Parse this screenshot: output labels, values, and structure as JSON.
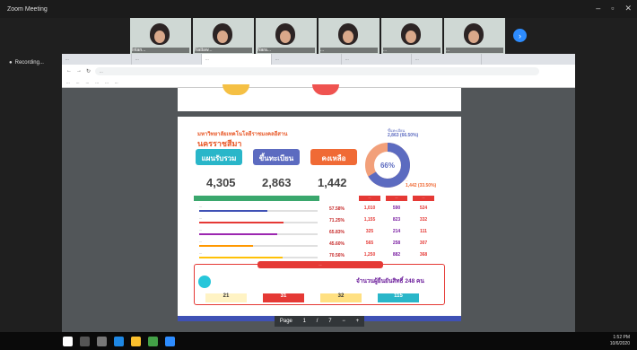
{
  "window": {
    "title": "Zoom Meeting"
  },
  "gallery": {
    "participants": [
      {
        "name": "Intan..."
      },
      {
        "name": "Nattaw..."
      },
      {
        "name": "Nara..."
      },
      {
        "name": "..."
      },
      {
        "name": "..."
      },
      {
        "name": "..."
      }
    ]
  },
  "recording": {
    "label": "Recording..."
  },
  "browser": {
    "tabs": [
      {
        "label": "..."
      },
      {
        "label": "..."
      },
      {
        "label": "..."
      },
      {
        "label": "..."
      },
      {
        "label": "..."
      },
      {
        "label": "..."
      }
    ],
    "url": "...",
    "bookmarks": [
      {
        "label": "..."
      },
      {
        "label": "..."
      },
      {
        "label": "..."
      },
      {
        "label": "..."
      },
      {
        "label": "..."
      },
      {
        "label": "..."
      }
    ]
  },
  "slide": {
    "heading_line1": "มหาวิทยาลัยเทคโนโลยีราชมงคลอีสาน",
    "heading_line2": "นครราชสีมา",
    "pills": [
      {
        "label": "แผนรับรวม",
        "value": "4,305",
        "color": "#29b6c9"
      },
      {
        "label": "ขึ้นทะเบียน",
        "value": "2,863",
        "color": "#5c6bc0"
      },
      {
        "label": "คงเหลือ",
        "value": "1,442",
        "color": "#f06a35"
      }
    ],
    "donut": {
      "center_label": "66%",
      "registered_label": "ขึ้นทะเบียน",
      "registered_value": "2,863 (66.50%)",
      "remaining_label": "...",
      "remaining_value": "1,442 (33.50%)",
      "registered_fraction": 0.665
    },
    "table_headers": [
      "...",
      "...",
      "..."
    ],
    "rows": [
      {
        "label": "...",
        "pct": "57.58%",
        "fill": 0.5758,
        "color": "#3f51b5",
        "c1": "1,010",
        "c2": "590",
        "c3": "524"
      },
      {
        "label": "...",
        "pct": "71.25%",
        "fill": 0.7125,
        "color": "#e53935",
        "c1": "1,155",
        "c2": "823",
        "c3": "332"
      },
      {
        "label": "...",
        "pct": "65.83%",
        "fill": 0.6583,
        "color": "#9c27b0",
        "c1": "325",
        "c2": "214",
        "c3": "111"
      },
      {
        "label": "...",
        "pct": "45.60%",
        "fill": 0.456,
        "color": "#ff9800",
        "c1": "565",
        "c2": "258",
        "c3": "307"
      },
      {
        "label": "...",
        "pct": "70.56%",
        "fill": 0.7056,
        "color": "#ffc107",
        "c1": "1,250",
        "c2": "882",
        "c3": "368"
      }
    ],
    "banner_title": "...",
    "total_text": "จำนวนผู้ยืนยันสิทธิ์ 248 คน",
    "banner_boxes": [
      "21",
      "31",
      "32",
      "115"
    ]
  },
  "pdf_toolbar": {
    "page_label": "Page",
    "page": "1",
    "sep": "/",
    "total": "7"
  },
  "taskbar": {
    "time": "1:52 PM",
    "date": "10/6/2020"
  }
}
